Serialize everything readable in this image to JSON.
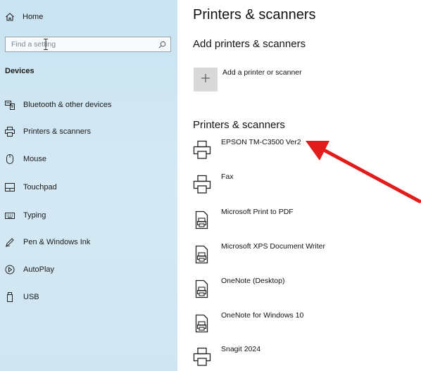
{
  "sidebar": {
    "home_label": "Home",
    "search_placeholder": "Find a setting",
    "section_title": "Devices",
    "items": [
      {
        "label": "Bluetooth & other devices",
        "icon": "bluetooth-devices-icon"
      },
      {
        "label": "Printers & scanners",
        "icon": "printer-icon"
      },
      {
        "label": "Mouse",
        "icon": "mouse-icon"
      },
      {
        "label": "Touchpad",
        "icon": "touchpad-icon"
      },
      {
        "label": "Typing",
        "icon": "keyboard-icon"
      },
      {
        "label": "Pen & Windows Ink",
        "icon": "pen-icon"
      },
      {
        "label": "AutoPlay",
        "icon": "autoplay-icon"
      },
      {
        "label": "USB",
        "icon": "usb-icon"
      }
    ]
  },
  "main": {
    "title": "Printers & scanners",
    "add_section_title": "Add printers & scanners",
    "add_button_label": "Add a printer or scanner",
    "list_section_title": "Printers & scanners",
    "printers": [
      {
        "name": "EPSON TM-C3500 Ver2",
        "icon": "printer-icon"
      },
      {
        "name": "Fax",
        "icon": "printer-icon"
      },
      {
        "name": "Microsoft Print to PDF",
        "icon": "document-printer-icon"
      },
      {
        "name": "Microsoft XPS Document Writer",
        "icon": "document-printer-icon"
      },
      {
        "name": "OneNote (Desktop)",
        "icon": "document-printer-icon"
      },
      {
        "name": "OneNote for Windows 10",
        "icon": "document-printer-icon"
      },
      {
        "name": "Snagit 2024",
        "icon": "printer-icon"
      }
    ]
  },
  "colors": {
    "sidebar_bg": "#cfe5f1",
    "arrow": "#e21b1b"
  }
}
